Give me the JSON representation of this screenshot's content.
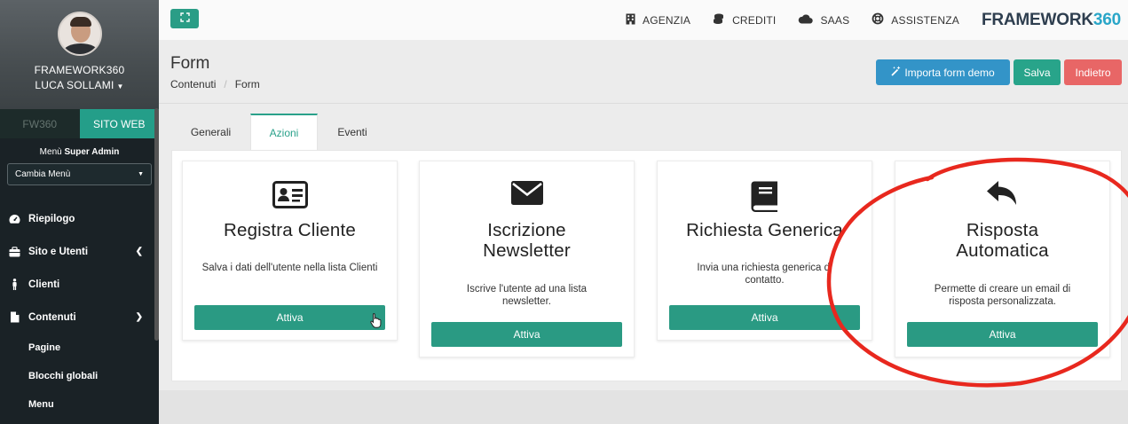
{
  "sidebar": {
    "brand": "FRAMEWORK360",
    "user": "LUCA SOLLAMI",
    "switch": {
      "fw": "FW360",
      "site": "SITO WEB"
    },
    "menu_label_prefix": "Menù",
    "menu_label_bold": "Super Admin",
    "menu_select_value": "Cambia Menù",
    "items": [
      {
        "label": "Riepilogo"
      },
      {
        "label": "Sito e Utenti"
      },
      {
        "label": "Clienti"
      },
      {
        "label": "Contenuti"
      }
    ],
    "subitems": [
      {
        "label": "Pagine"
      },
      {
        "label": "Blocchi globali"
      },
      {
        "label": "Menu"
      }
    ]
  },
  "topbar": {
    "nav": [
      {
        "label": "AGENZIA",
        "icon": "building-icon"
      },
      {
        "label": "CREDITI",
        "icon": "coins-icon"
      },
      {
        "label": "SAAS",
        "icon": "cloud-icon"
      },
      {
        "label": "ASSISTENZA",
        "icon": "life-ring-icon"
      }
    ],
    "logo_main": "FRAMEWORK",
    "logo_accent": "360"
  },
  "page": {
    "title": "Form",
    "breadcrumb": [
      "Contenuti",
      "/",
      "Form"
    ],
    "buttons": {
      "import": "Importa form demo",
      "save": "Salva",
      "back": "Indietro"
    }
  },
  "tabs": [
    {
      "label": "Generali",
      "active": false
    },
    {
      "label": "Azioni",
      "active": true
    },
    {
      "label": "Eventi",
      "active": false
    }
  ],
  "cards": [
    {
      "title": "Registra Cliente",
      "description": "Salva i dati dell'utente nella lista Clienti",
      "button": "Attiva",
      "icon": "id-card-icon"
    },
    {
      "title": "Iscrizione Newsletter",
      "description": "Iscrive l'utente ad una lista newsletter.",
      "button": "Attiva",
      "icon": "envelope-icon"
    },
    {
      "title": "Richiesta Generica",
      "description": "Invia una richiesta generica di contatto.",
      "button": "Attiva",
      "icon": "book-icon"
    },
    {
      "title": "Risposta Automatica",
      "description": "Permette di creare un email di risposta personalizzata.",
      "button": "Attiva",
      "icon": "reply-icon"
    }
  ],
  "colors": {
    "accent": "#2a9a83",
    "sidebar": "#1a2226",
    "import": "#3394c8",
    "back": "#e86666",
    "annotation": "#e8281e"
  }
}
